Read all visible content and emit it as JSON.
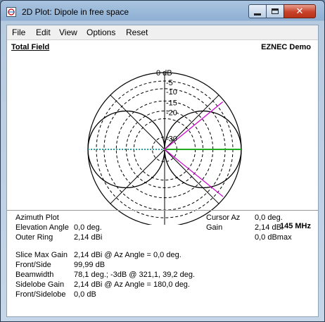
{
  "window": {
    "title": "2D Plot: Dipole in free space"
  },
  "menu": [
    "File",
    "Edit",
    "View",
    "Options",
    "Reset"
  ],
  "plot": {
    "total_field_label": "Total Field",
    "program_label": "EZNEC Demo",
    "frequency": "145 MHz",
    "ring_labels": [
      "0 dB",
      "-5",
      "-10",
      "-15",
      "-20",
      "-30"
    ],
    "colors": {
      "pattern": "#000000",
      "slice": "#22aa22",
      "cursor": "#cc00cc",
      "horizon": "#2aa0a0"
    }
  },
  "info": {
    "left": [
      {
        "label": "Azimuth Plot",
        "value": ""
      },
      {
        "label": "Elevation Angle",
        "value": "0,0 deg."
      },
      {
        "label": "Outer Ring",
        "value": "2,14 dBi"
      }
    ],
    "right": [
      {
        "label": "Cursor Az",
        "value": "0,0 deg."
      },
      {
        "label": "Gain",
        "value": "2,14 dBi"
      },
      {
        "label": "",
        "value": "0,0 dBmax"
      }
    ],
    "bottom": [
      {
        "label": "Slice Max Gain",
        "value": "2,14 dBi @ Az Angle = 0,0 deg."
      },
      {
        "label": "Front/Side",
        "value": "99,99 dB"
      },
      {
        "label": "Beamwidth",
        "value": "78,1 deg.; -3dB @ 321,1, 39,2 deg."
      },
      {
        "label": "Sidelobe Gain",
        "value": "2,14 dBi @ Az Angle = 180,0 deg."
      },
      {
        "label": "Front/Sidelobe",
        "value": "0,0 dB"
      }
    ]
  }
}
